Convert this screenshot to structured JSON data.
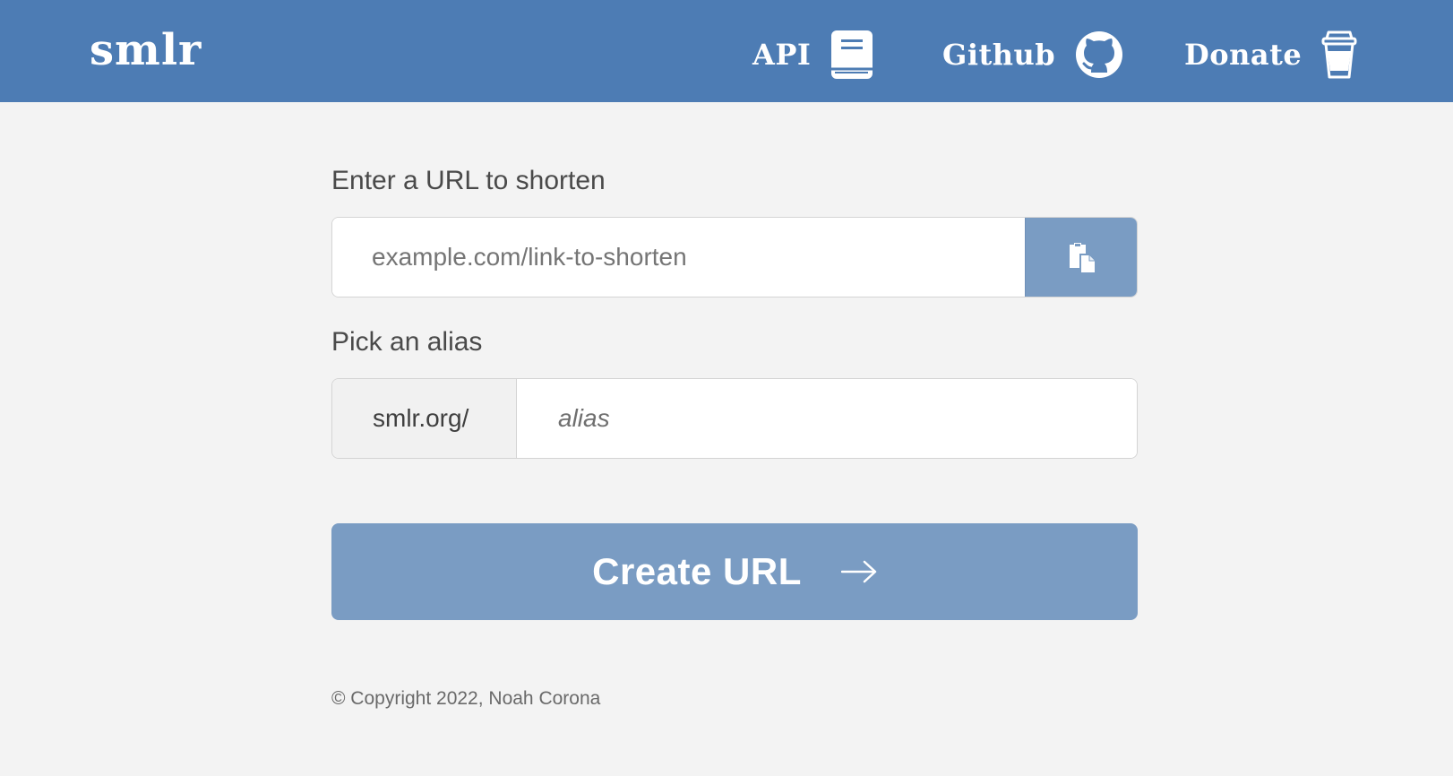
{
  "app": {
    "logo": "smlr"
  },
  "header": {
    "nav": [
      {
        "label": "API",
        "icon": "book-icon"
      },
      {
        "label": "Github",
        "icon": "github-icon"
      },
      {
        "label": "Donate",
        "icon": "coffee-cup-icon"
      }
    ]
  },
  "form": {
    "url_label": "Enter a URL to shorten",
    "url_placeholder": "example.com/link-to-shorten",
    "url_value": "",
    "paste_icon": "clipboard-paste-icon",
    "alias_label": "Pick an alias",
    "alias_prefix": "smlr.org/",
    "alias_placeholder": "alias",
    "alias_value": "",
    "submit_label": "Create URL",
    "submit_icon": "arrow-right-icon"
  },
  "footer": {
    "copyright": "© Copyright 2022, Noah Corona"
  },
  "colors": {
    "header_bg": "#4d7cb4",
    "accent": "#7a9cc3",
    "page_bg": "#f3f3f3",
    "text": "#4a4a4a"
  }
}
